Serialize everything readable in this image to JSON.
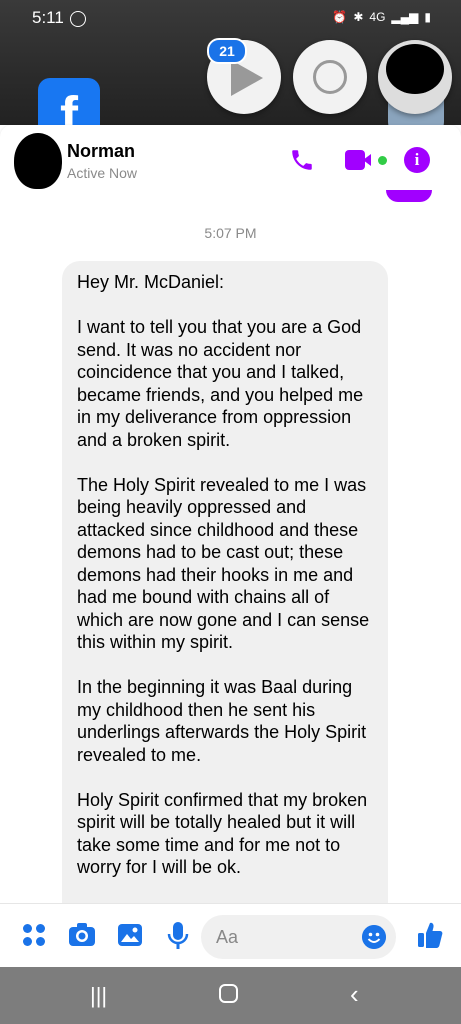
{
  "status_bar": {
    "time": "5:11",
    "network": "4G"
  },
  "chat_heads": {
    "unread_badge": "21"
  },
  "background_icons": {
    "facebook_letter": "f"
  },
  "header": {
    "name": "Norman",
    "activity": "Active Now",
    "info_symbol": "i"
  },
  "conversation": {
    "timestamp": "5:07 PM",
    "message": "Hey Mr. McDaniel:\n\nI want to tell you that you are a God send. It was no accident nor coincidence that you and I talked, became friends, and you helped me in my deliverance from oppression and a broken spirit.\n\nThe Holy Spirit revealed to me I was being heavily oppressed and attacked since childhood and these demons had to be cast out; these demons had their hooks in me and had me bound with chains all of which are now gone and I can sense this within my spirit.\n\nIn the beginning it was Baal during my childhood then he sent his underlings afterwards the Holy Spirit revealed to me.\n\nHoly Spirit confirmed that my broken spirit will be totally healed but it will take some time and for me not to worry for I will be ok."
  },
  "composer": {
    "placeholder": "Aa"
  },
  "colors": {
    "accent": "#a100ff",
    "messenger_blue": "#1a73e8",
    "bubble_bg": "#f0f0f0"
  }
}
